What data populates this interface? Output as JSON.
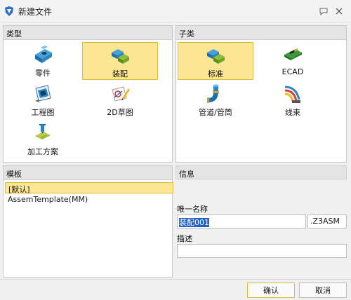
{
  "window": {
    "title": "新建文件",
    "help_icon": "chat-bubble-icon",
    "close_icon": "close-icon"
  },
  "type_panel": {
    "header": "类型",
    "items": [
      {
        "label": "零件",
        "icon": "part-icon"
      },
      {
        "label": "装配",
        "icon": "assembly-icon",
        "selected": true
      },
      {
        "label": "工程图",
        "icon": "drawing-icon"
      },
      {
        "label": "2D草图",
        "icon": "sketch-icon"
      },
      {
        "label": "加工方案",
        "icon": "machining-plan-icon"
      }
    ]
  },
  "subtype_panel": {
    "header": "子类",
    "items": [
      {
        "label": "标准",
        "icon": "assembly-icon",
        "selected": true
      },
      {
        "label": "ECAD",
        "icon": "ecad-board-icon"
      },
      {
        "label": "管道/管筒",
        "icon": "piping-icon"
      },
      {
        "label": "线束",
        "icon": "harness-icon"
      }
    ]
  },
  "template_panel": {
    "header": "模板",
    "items": [
      {
        "label": "[默认]",
        "selected": true
      },
      {
        "label": "AssemTemplate(MM)"
      }
    ]
  },
  "info_panel": {
    "header": "信息",
    "name_label": "唯一名称",
    "name_value": "装配001",
    "extension": ".Z3ASM",
    "desc_label": "描述",
    "desc_value": ""
  },
  "buttons": {
    "ok": "确认",
    "cancel": "取消"
  },
  "colors": {
    "selection": "#fce693",
    "selection_border": "#e2b93b",
    "text_highlight": "#1e62c9"
  }
}
